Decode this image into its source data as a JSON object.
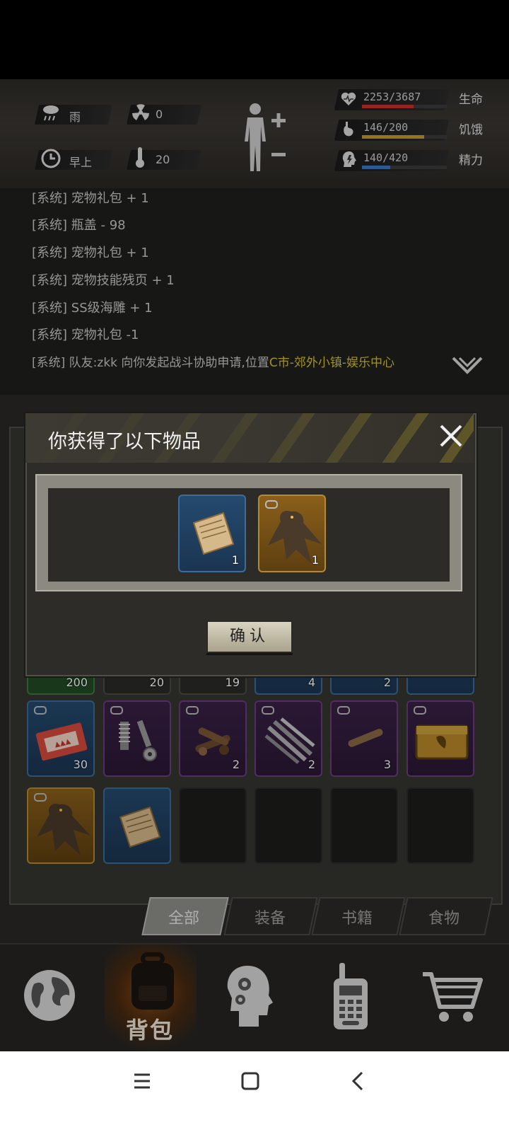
{
  "status": {
    "weather": "雨",
    "radiation": "0",
    "time_of_day": "早上",
    "temperature": "20",
    "life": {
      "value": "2253/3687",
      "label": "生命",
      "fill": 0.611,
      "color": "#c8322c"
    },
    "hunger": {
      "value": "146/200",
      "label": "饥饿",
      "fill": 0.73,
      "color": "#c79a2a"
    },
    "energy": {
      "value": "140/420",
      "label": "精力",
      "fill": 0.333,
      "color": "#3b78c4"
    }
  },
  "log": {
    "lines": [
      {
        "prefix": "[系统]",
        "text": "宠物礼包 + 1"
      },
      {
        "prefix": "[系统]",
        "text": "瓶盖 - 98"
      },
      {
        "prefix": "[系统]",
        "text": "宠物礼包 + 1"
      },
      {
        "prefix": "[系统]",
        "text": "宠物技能残页 + 1"
      },
      {
        "prefix": "[系统]",
        "text": "SS级海雕 + 1"
      },
      {
        "prefix": "[系统]",
        "text": "宠物礼包 -1"
      },
      {
        "prefix": "[系统]",
        "text": "队友:zkk 向你发起战斗协助申请,位置",
        "location": "C市-郊外小镇-娱乐中心"
      }
    ]
  },
  "inventory": {
    "row_partial": [
      {
        "rarity": "green",
        "count": "200"
      },
      {
        "rarity": "gray",
        "count": "20"
      },
      {
        "rarity": "gray",
        "count": "19"
      },
      {
        "rarity": "blue",
        "count": "4"
      },
      {
        "rarity": "blue",
        "count": "2"
      },
      {
        "rarity": "blue",
        "count": ""
      }
    ],
    "row2": [
      {
        "icon": "ticket-icon",
        "rarity": "blue",
        "count": "30"
      },
      {
        "icon": "bolts-icon",
        "rarity": "purple",
        "count": ""
      },
      {
        "icon": "wood-pile-icon",
        "rarity": "purple",
        "count": "2"
      },
      {
        "icon": "metal-rods-icon",
        "rarity": "purple",
        "count": "2"
      },
      {
        "icon": "wood-stick-icon",
        "rarity": "purple",
        "count": "3"
      },
      {
        "icon": "chest-icon",
        "rarity": "purple",
        "count": ""
      }
    ],
    "row3": [
      {
        "icon": "eagle-icon",
        "rarity": "gold",
        "count": ""
      },
      {
        "icon": "torn-page-icon",
        "rarity": "blue",
        "count": ""
      }
    ]
  },
  "tabs": [
    {
      "label": "全部",
      "active": true
    },
    {
      "label": "装备",
      "active": false
    },
    {
      "label": "书籍",
      "active": false
    },
    {
      "label": "食物",
      "active": false
    }
  ],
  "bottom_nav": {
    "backpack_label": "背包"
  },
  "dialog": {
    "title": "你获得了以下物品",
    "items": [
      {
        "icon": "torn-page-icon",
        "rarity": "blue",
        "count": "1"
      },
      {
        "icon": "eagle-icon",
        "rarity": "gold",
        "count": "1"
      }
    ],
    "confirm_label": "确认"
  }
}
